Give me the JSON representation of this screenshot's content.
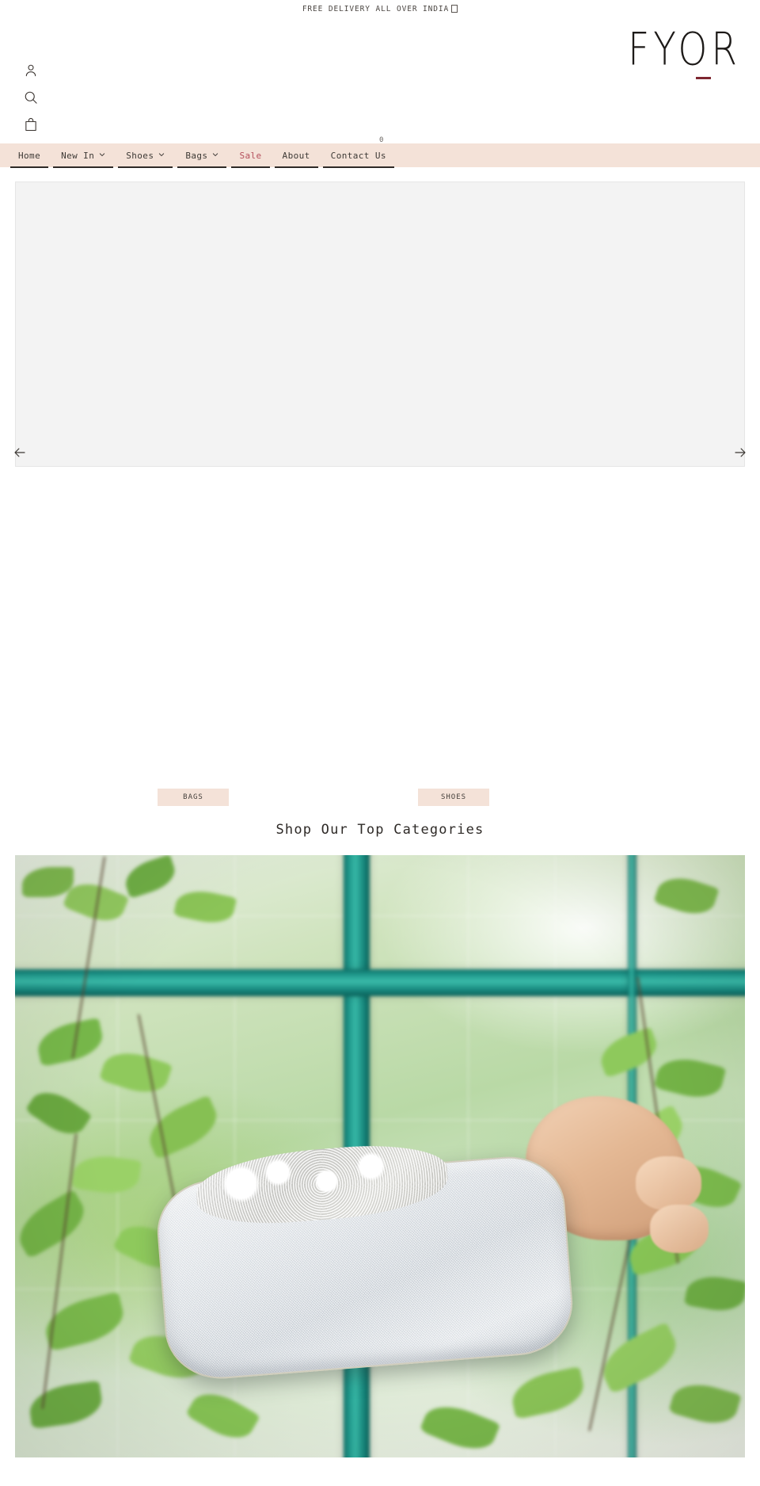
{
  "announcement": {
    "text": "FREE DELIVERY ALL OVER INDIA",
    "flag_icon": "india-flag-icon"
  },
  "header": {
    "logo_text": "FYOR",
    "logo_underline_color": "#7e2630",
    "icons": [
      {
        "name": "account-icon",
        "label": "Account"
      },
      {
        "name": "search-icon",
        "label": "Search"
      },
      {
        "name": "cart-icon",
        "label": "Cart"
      }
    ],
    "cart_count": "0"
  },
  "nav": {
    "background_color": "#f4e2d8",
    "sale_color": "#b5505c",
    "items": [
      {
        "label": "Home",
        "has_dropdown": false,
        "highlight": false
      },
      {
        "label": "New In",
        "has_dropdown": true,
        "highlight": false
      },
      {
        "label": "Shoes",
        "has_dropdown": true,
        "highlight": false
      },
      {
        "label": "Bags",
        "has_dropdown": true,
        "highlight": false
      },
      {
        "label": "Sale",
        "has_dropdown": false,
        "highlight": true
      },
      {
        "label": "About",
        "has_dropdown": false,
        "highlight": false
      },
      {
        "label": "Contact Us",
        "has_dropdown": false,
        "highlight": false
      }
    ]
  },
  "hero": {
    "prev_icon": "arrow-left-icon",
    "next_icon": "arrow-right-icon",
    "placeholder_color": "#f3f3f3"
  },
  "collections": {
    "buttons": [
      {
        "label": "BAGS"
      },
      {
        "label": "SHOES"
      }
    ]
  },
  "top_categories": {
    "heading": "Shop Our Top Categories",
    "image_alt": "silver glitter clutch bag with crystal floral clasp held in hand before a teal window frame with green ivy"
  }
}
